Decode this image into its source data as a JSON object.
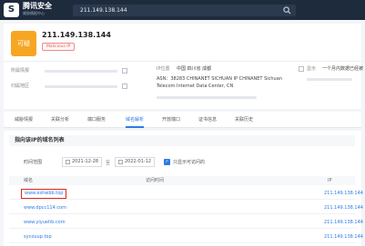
{
  "header": {
    "brand": "腾讯安全",
    "brand_sub": "威胁情报中心",
    "search_value": "211.149.138.144",
    "logo_letter": "S"
  },
  "summary": {
    "badge": "可疑",
    "ip": "211.149.138.144",
    "tag": "Malicious IP",
    "fields": [
      {
        "label": "所属情报",
        "value": ""
      },
      {
        "label": "IP位置",
        "value": "中国 四川省 成都"
      },
      {
        "label": "ASN",
        "value": "ASN：38283 CHINANET SICHUAN IP CHINANET Sichuan"
      },
      {
        "label": "",
        "value": "Telecom Internet Data Center, CN"
      },
      {
        "label": "",
        "value": ""
      },
      {
        "label": "显示",
        "value": "一个月内数据已经被"
      }
    ]
  },
  "tabs": [
    {
      "label": "威胁情报"
    },
    {
      "label": "关联分析"
    },
    {
      "label": "端口服务"
    },
    {
      "label": "域名解析"
    },
    {
      "label": "开放端口"
    },
    {
      "label": "证书信息"
    },
    {
      "label": "关联历史"
    }
  ],
  "panel": {
    "title": "指向该IP的域名列表",
    "filter_label": "时间范围",
    "date_from": "2021-12-28",
    "date_to": "2022-01-12",
    "date_sep": "至",
    "checkbox_label": "只显示可访问的",
    "columns": [
      "域名",
      "访问时间",
      "IP"
    ],
    "rows": [
      {
        "domain": "www.eshwbb.top",
        "ip": "211.149.138.144",
        "highlight": true
      },
      {
        "domain": "www.dpcc114.com",
        "ip": "211.149.138.144",
        "highlight": false
      },
      {
        "domain": "www.yiyuehb.com",
        "ip": "211.149.138.144",
        "highlight": false
      },
      {
        "domain": "sycouup.top",
        "ip": "211.149.138.144",
        "highlight": false
      }
    ]
  },
  "colors": {
    "accent": "#2c7be5",
    "topbar": "#1e2b3c",
    "warning": "#f6a623",
    "highlight": "#e02424"
  }
}
